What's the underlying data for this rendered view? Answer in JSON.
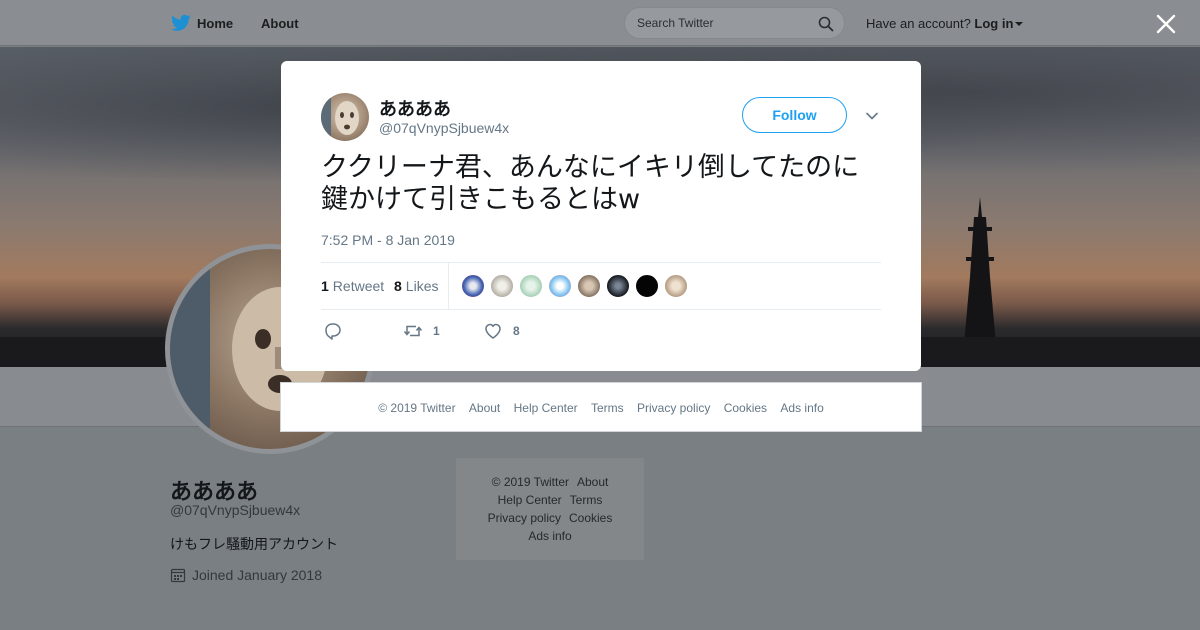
{
  "nav": {
    "home_label": "Home",
    "about_label": "About",
    "search_placeholder": "Search Twitter",
    "account_prompt": "Have an account?",
    "login_label": "Log in"
  },
  "profile": {
    "name": "ああああ",
    "handle": "@07qVnypSjbuew4x",
    "bio": "けもフレ騒動用アカウント",
    "joined": "Joined January 2018"
  },
  "side_footer": {
    "links": [
      "© 2019 Twitter",
      "About",
      "Help Center",
      "Terms",
      "Privacy policy",
      "Cookies",
      "Ads info"
    ]
  },
  "tweet": {
    "author_name": "ああああ",
    "author_handle": "@07qVnypSjbuew4x",
    "follow_label": "Follow",
    "text": "ククリーナ君、あんなにイキリ倒してたのに鍵かけて引きこもるとはw",
    "timestamp": "7:52 PM - 8 Jan 2019",
    "retweet_count": "1",
    "retweet_label": "Retweet",
    "like_count": "8",
    "like_label": "Likes",
    "action_retweet_count": "1",
    "action_like_count": "8"
  },
  "modal_footer": {
    "links": [
      "© 2019 Twitter",
      "About",
      "Help Center",
      "Terms",
      "Privacy policy",
      "Cookies",
      "Ads info"
    ]
  },
  "colors": {
    "accent": "#1da1f2",
    "muted_text": "#657786"
  },
  "icons": [
    "twitter-bird-icon",
    "search-icon",
    "close-icon",
    "chevron-down-icon",
    "reply-icon",
    "retweet-icon",
    "heart-icon",
    "calendar-icon"
  ]
}
